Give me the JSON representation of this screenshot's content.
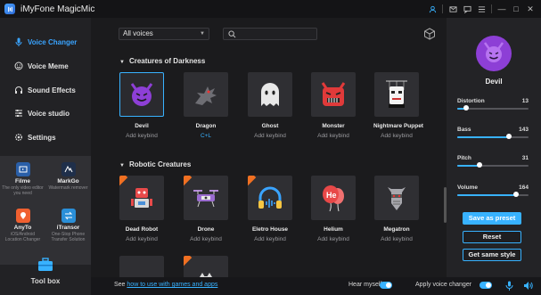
{
  "app": {
    "title": "iMyFone MagicMic"
  },
  "titlebar": {
    "icons": [
      "user-icon",
      "mail-icon",
      "chat-icon",
      "menu-icon",
      "minimize-icon",
      "maximize-icon",
      "close-icon"
    ],
    "minimize_glyph": "—",
    "maximize_glyph": "□",
    "close_glyph": "✕"
  },
  "sidebar": {
    "items": [
      {
        "label": "Voice Changer",
        "icon": "microphone-icon",
        "active": true
      },
      {
        "label": "Voice Meme",
        "icon": "smiley-icon",
        "active": false
      },
      {
        "label": "Sound Effects",
        "icon": "headphones-icon",
        "active": false
      },
      {
        "label": "Voice studio",
        "icon": "sliders-icon",
        "active": false
      },
      {
        "label": "Settings",
        "icon": "gear-icon",
        "active": false
      }
    ],
    "tools": [
      {
        "name": "Filme",
        "desc": "The only video editor you need",
        "icon": "film-icon",
        "color": "#2a5fa8"
      },
      {
        "name": "MarkGo",
        "desc": "Watermark remover",
        "icon": "markgo-icon",
        "color": "#1f2f4a"
      },
      {
        "name": "AnyTo",
        "desc": "iOS/Android Location Changer",
        "icon": "location-icon",
        "color": "#f06030"
      },
      {
        "name": "iTransor",
        "desc": "One-Stop Phone Transfer Solution",
        "icon": "transfer-icon",
        "color": "#2a8fd8"
      }
    ],
    "toolbox_label": "Tool box"
  },
  "main": {
    "voice_select": "All voices",
    "search_placeholder": "",
    "sections": [
      {
        "title": "Creatures of Darkness",
        "voices": [
          {
            "name": "Devil",
            "key": "Add keybind",
            "selected": true
          },
          {
            "name": "Dragon",
            "key": "C+L",
            "selected": false
          },
          {
            "name": "Ghost",
            "key": "Add keybind",
            "selected": false
          },
          {
            "name": "Monster",
            "key": "Add keybind",
            "selected": false
          },
          {
            "name": "Nightmare Puppet",
            "key": "Add keybind",
            "selected": false
          }
        ]
      },
      {
        "title": "Robotic Creatures",
        "voices": [
          {
            "name": "Dead Robot",
            "key": "Add keybind",
            "new": true
          },
          {
            "name": "Drone",
            "key": "Add keybind",
            "new": true
          },
          {
            "name": "Eletro House",
            "key": "Add keybind",
            "new": true
          },
          {
            "name": "Helium",
            "key": "Add keybind",
            "new": false
          },
          {
            "name": "Megatron",
            "key": "Add keybind",
            "new": false
          }
        ]
      }
    ]
  },
  "right_panel": {
    "selected_voice": "Devil",
    "sliders": [
      {
        "label": "Distortion",
        "value": "13",
        "fraction": 0.13
      },
      {
        "label": "Bass",
        "value": "143",
        "fraction": 0.72
      },
      {
        "label": "Pitch",
        "value": "31",
        "fraction": 0.31
      },
      {
        "label": "Volume",
        "value": "164",
        "fraction": 0.82
      }
    ],
    "save_label": "Save as preset",
    "reset_label": "Reset",
    "same_label": "Get same style"
  },
  "bottom": {
    "see_prefix": "See ",
    "see_link": "how to use with games and apps",
    "hear_label": "Hear myself",
    "apply_label": "Apply voice changer"
  },
  "colors": {
    "accent": "#38b2ff",
    "devil": "#8d3fd6",
    "ribbon": "#f07022"
  }
}
